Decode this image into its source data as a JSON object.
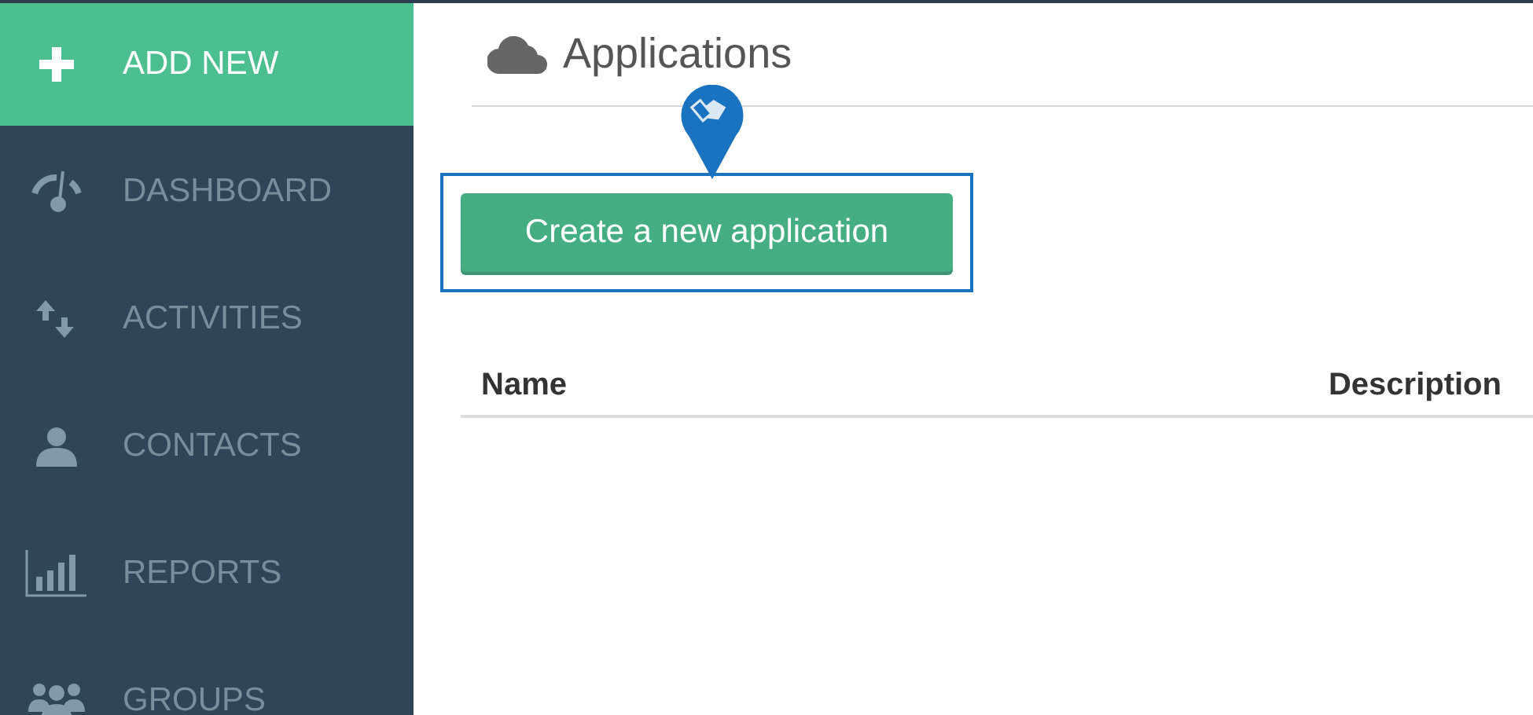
{
  "sidebar": {
    "items": [
      {
        "label": "ADD NEW",
        "selected": true
      },
      {
        "label": "DASHBOARD",
        "selected": false
      },
      {
        "label": "ACTIVITIES",
        "selected": false
      },
      {
        "label": "CONTACTS",
        "selected": false
      },
      {
        "label": "REPORTS",
        "selected": false
      },
      {
        "label": "GROUPS",
        "selected": false
      }
    ]
  },
  "page": {
    "title": "Applications",
    "create_button": "Create a new application",
    "highlighted": true
  },
  "table": {
    "columns": [
      "Name",
      "Description"
    ]
  }
}
